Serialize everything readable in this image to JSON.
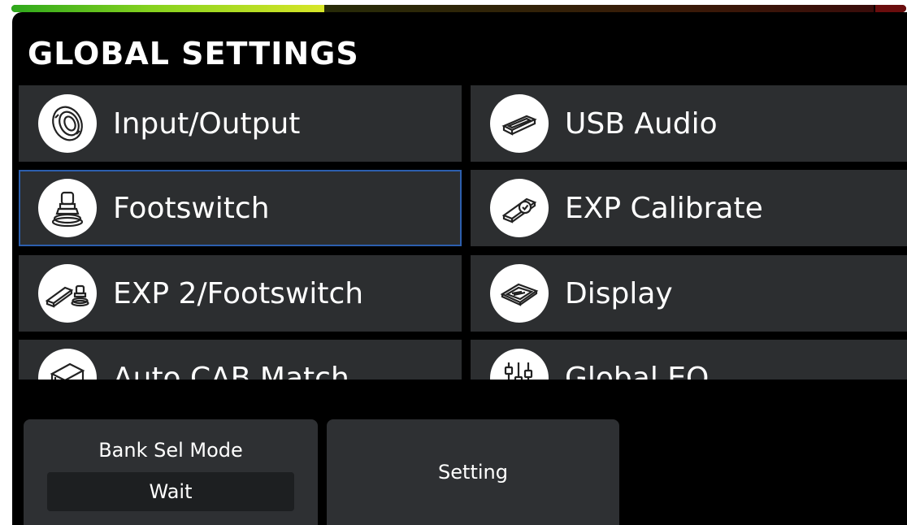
{
  "meter": {
    "level": 0.35
  },
  "header": {
    "title": "GLOBAL SETTINGS"
  },
  "menu": {
    "items": [
      {
        "label": "Input/Output",
        "icon": "jack-icon"
      },
      {
        "label": "USB Audio",
        "icon": "usb-port-icon"
      },
      {
        "label": "Footswitch",
        "icon": "footswitch-icon",
        "selected": true
      },
      {
        "label": "EXP Calibrate",
        "icon": "pedal-check-icon"
      },
      {
        "label": "EXP 2/Footswitch",
        "icon": "pedal-footswitch-icon"
      },
      {
        "label": "Display",
        "icon": "display-icon"
      },
      {
        "label": "Auto CAB Match",
        "icon": "cab-icon"
      },
      {
        "label": "Global EQ",
        "icon": "eq-sliders-icon"
      }
    ]
  },
  "bottom": {
    "bank_sel": {
      "title": "Bank Sel Mode",
      "value": "Wait"
    },
    "setting": {
      "label": "Setting"
    }
  },
  "colors": {
    "background": "#000000",
    "tile": "#2c2e30",
    "selection": "#2d5fae",
    "meter_green": "#2ea81c",
    "meter_yellow": "#d8e628"
  }
}
